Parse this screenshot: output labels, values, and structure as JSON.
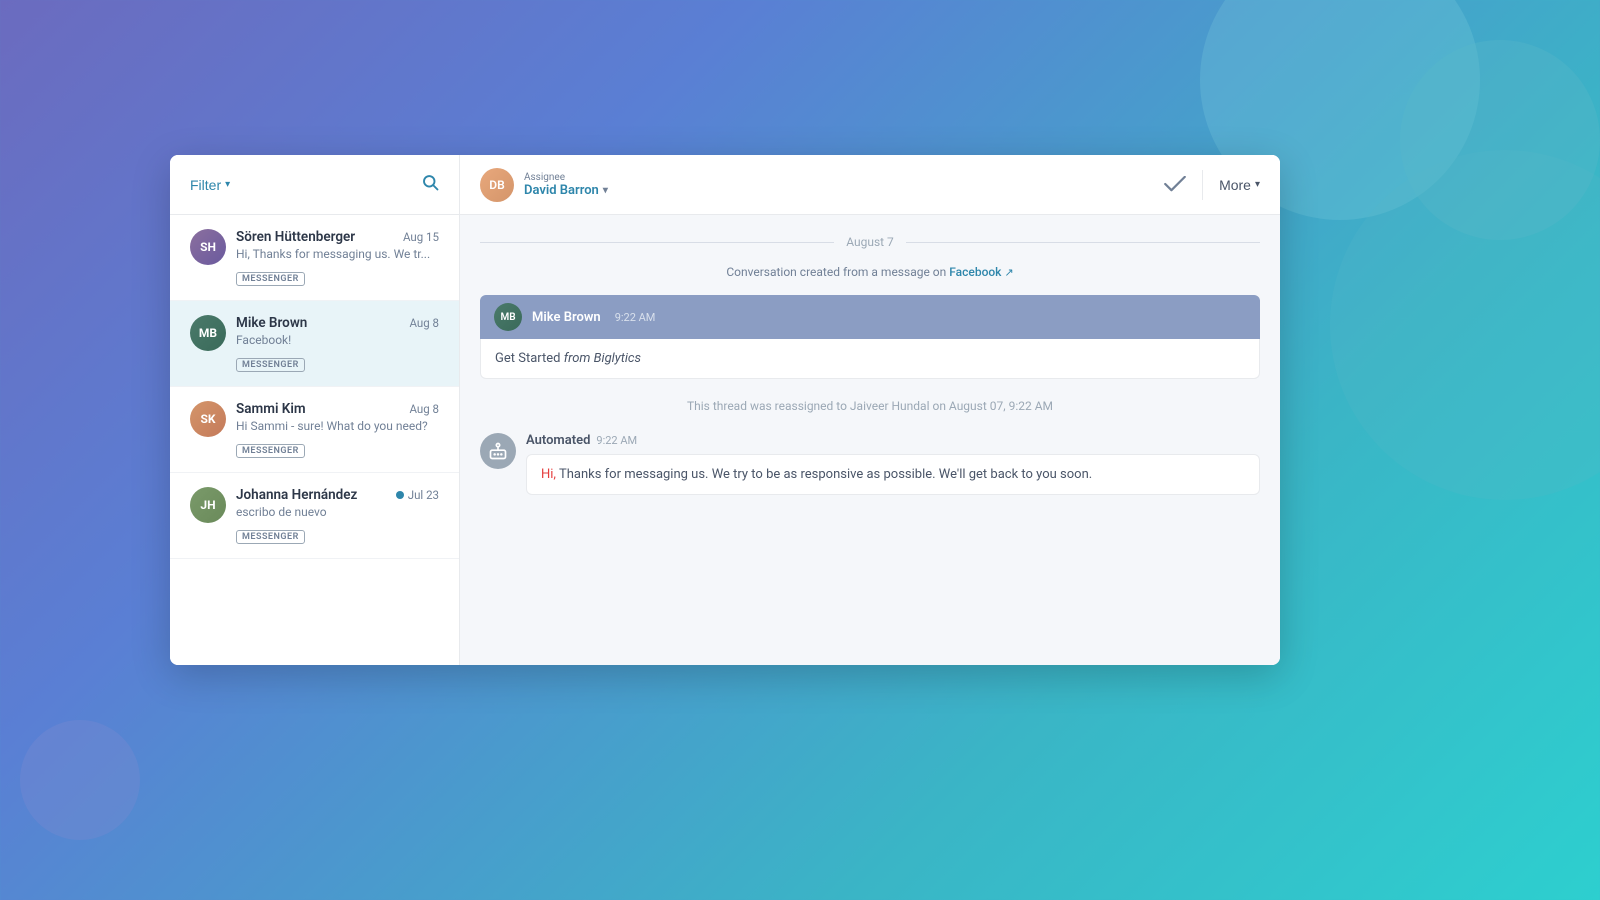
{
  "background": {
    "gradient_desc": "purple-blue to teal"
  },
  "sidebar": {
    "header": {
      "filter_label": "Filter",
      "filter_chevron": "▾",
      "search_aria": "Search"
    },
    "conversations": [
      {
        "id": "soren",
        "name": "Sören Hüttenberger",
        "date": "Aug 15",
        "preview": "Hi, Thanks for messaging us. We tr...",
        "badge": "MESSENGER",
        "active": false,
        "unread": false,
        "avatar_initials": "SH",
        "avatar_color": "#8b6f9e"
      },
      {
        "id": "mike",
        "name": "Mike Brown",
        "date": "Aug 8",
        "preview": "Facebook!",
        "badge": "MESSENGER",
        "active": true,
        "unread": false,
        "avatar_initials": "MB",
        "avatar_color": "#4a7a6a"
      },
      {
        "id": "sammi",
        "name": "Sammi Kim",
        "date": "Aug 8",
        "preview": "Hi Sammi - sure! What do you need?",
        "badge": "MESSENGER",
        "active": false,
        "unread": false,
        "avatar_initials": "SK",
        "avatar_color": "#d4956a"
      },
      {
        "id": "johanna",
        "name": "Johanna Hernández",
        "date": "Jul 23",
        "preview": "escribo de nuevo",
        "badge": "MESSENGER",
        "active": false,
        "unread": true,
        "avatar_initials": "JH",
        "avatar_color": "#7a9a6a"
      }
    ]
  },
  "chat": {
    "header": {
      "assignee_label": "Assignee",
      "assignee_name": "David Barron",
      "assignee_chevron": "▾",
      "more_label": "More",
      "more_chevron": "▾"
    },
    "date_separator": "August 7",
    "system_message": {
      "text_before": "Conversation created from a message on ",
      "link_text": "Facebook",
      "link_icon": "↗"
    },
    "messages": [
      {
        "id": "msg1",
        "type": "user",
        "sender": "Mike Brown",
        "time": "9:22 AM",
        "body_plain": "Get Started ",
        "body_italic": "from Biglytics",
        "avatar_initials": "MB",
        "avatar_color": "#4a7a6a"
      }
    ],
    "reassign_notice": "This thread was reassigned to Jaiveer Hundal on August 07, 9:22 AM",
    "automated_message": {
      "sender": "Automated",
      "time": "9:22 AM",
      "hi_text": "Hi,",
      "body": "  Thanks for messaging us. We try to be as responsive as possible. We'll get back to you soon."
    }
  }
}
